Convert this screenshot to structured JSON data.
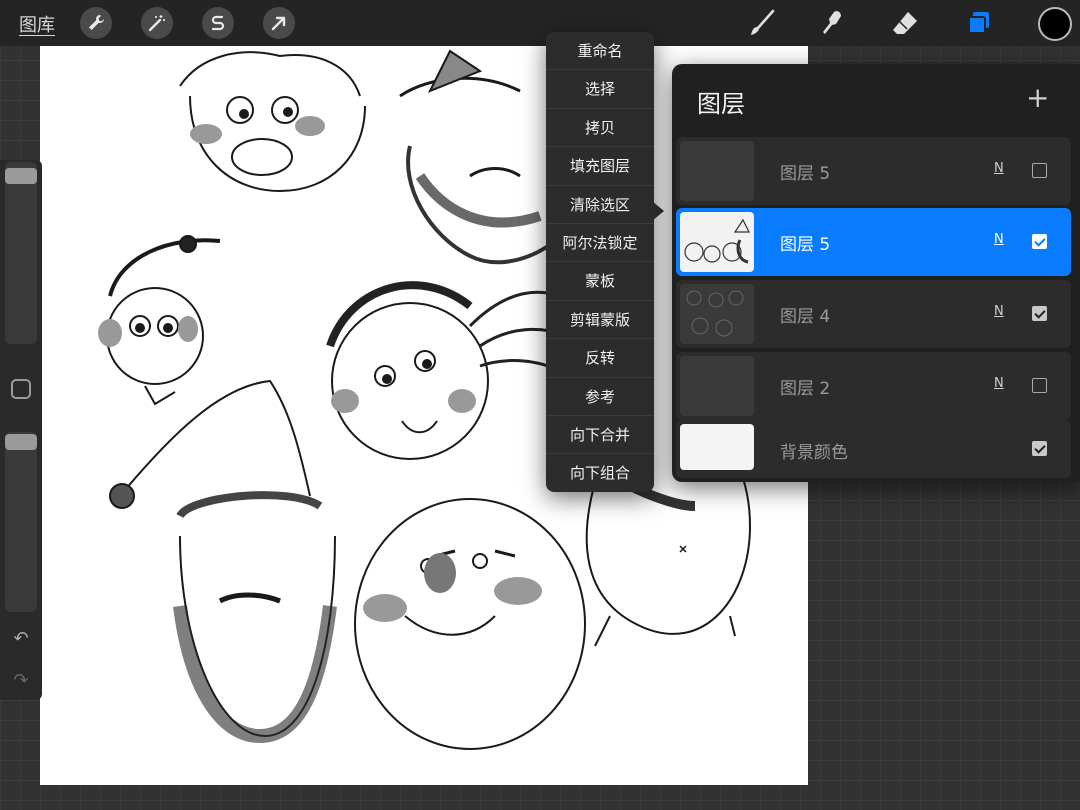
{
  "topbar": {
    "gallery_label": "图库",
    "left_tools": [
      "wrench-icon",
      "magic-wand-icon",
      "selection-s-icon",
      "transform-arrow-icon"
    ],
    "right_tools": [
      "brush-icon",
      "smudge-icon",
      "eraser-icon",
      "layers-icon"
    ],
    "active_color": "#000000",
    "accent": "#0a7cff"
  },
  "context_menu": {
    "items": [
      "重命名",
      "选择",
      "拷贝",
      "填充图层",
      "清除选区",
      "阿尔法锁定",
      "蒙板",
      "剪辑蒙版",
      "反转",
      "参考",
      "向下合并",
      "向下组合"
    ]
  },
  "layers_panel": {
    "title": "图层",
    "add_label": "+",
    "layers": [
      {
        "name": "图层 5",
        "blend": "N",
        "visible": false,
        "active": false
      },
      {
        "name": "图层 5",
        "blend": "N",
        "visible": true,
        "active": true
      },
      {
        "name": "图层 4",
        "blend": "N",
        "visible": true,
        "active": false
      },
      {
        "name": "图层 2",
        "blend": "N",
        "visible": false,
        "active": false
      },
      {
        "name": "背景颜色",
        "blend": "",
        "visible": true,
        "active": false
      }
    ]
  },
  "sidebar": {
    "undo_icon": "undo-icon",
    "redo_icon": "redo-icon"
  }
}
